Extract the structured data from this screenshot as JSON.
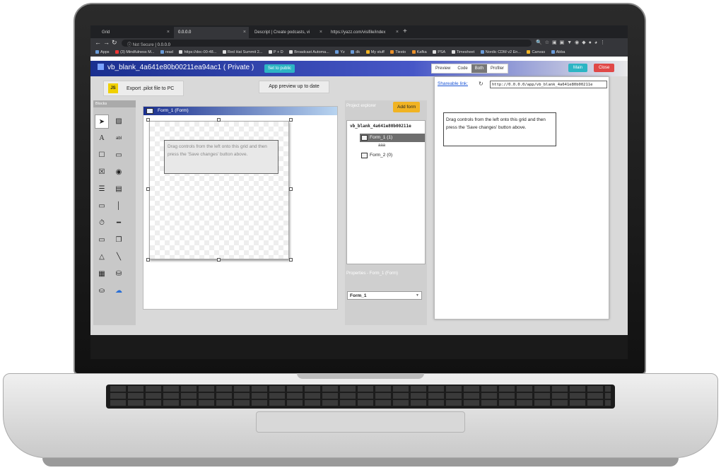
{
  "browser": {
    "tabs": [
      {
        "label": "Grid"
      },
      {
        "label": "0.0.0.0"
      },
      {
        "label": "Descript | Create podcasts, vi"
      },
      {
        "label": "https://yazz.com/visifile/index"
      }
    ],
    "security": "Not Secure",
    "url": "0.0.0.0",
    "bookmarks": [
      "Apps",
      "(3) Mindfulness M...",
      "read",
      "https://doc-00-48...",
      "Red Hat Summit 2...",
      "P + D",
      "Broadcast Automa...",
      "Yz",
      "dk",
      "My stuff",
      "Tiesto",
      "Kafka",
      "PSA",
      "Timesheet",
      "Nordic CDM v2 En...",
      "Canvas",
      "Abba"
    ]
  },
  "app": {
    "title": "vb_blank_4a641e80b00211ea94ac1 ( Private )",
    "set_public": "Set to public",
    "view_tabs": [
      "Preview",
      "Code",
      "Both",
      "Profiler"
    ],
    "selected_view": "Both",
    "main_label": "Main",
    "close_label": "Close",
    "export_label": "Export .pilot file to PC",
    "export_badge": "JS",
    "app_preview_label": "App preview up to date"
  },
  "blocks": {
    "title": "Blocks",
    "tools": [
      "pointer-icon",
      "image-icon",
      "text-label-icon",
      "textbox-icon",
      "checkbox-icon",
      "button-icon",
      "close-box-icon",
      "radio-icon",
      "list-icon",
      "form-list-icon",
      "progress-bar-icon",
      "slider-icon",
      "timer-icon",
      "line-thick-icon",
      "folder-icon",
      "copy-icon",
      "shapes-icon",
      "line-icon",
      "chart-icon",
      "database-icon",
      "db-query-icon",
      "cloud-icon"
    ],
    "text_tool_glyph": "A",
    "textbox_glyph": "abl"
  },
  "designer": {
    "form_title": "Form_1 (Form)",
    "hint": "Drag controls from the left onto this grid and then press the 'Save changes' button above."
  },
  "explorer": {
    "title": "Project explorer",
    "add_form": "Add form",
    "root": "vb_blank_4a641e80b00211e",
    "items": [
      {
        "label": "Form_1 (1)",
        "selected": true
      },
      {
        "label": "Form_2 (0)",
        "selected": false
      }
    ],
    "sub_item": "aaa"
  },
  "properties": {
    "title": "Properties - Form_1 (Form)",
    "selected": "Form_1"
  },
  "preview": {
    "share_label": "Shareable link:",
    "share_url": "http://0.0.0.0/app/vb_blank_4a641e80b00211e",
    "hint": "Drag controls from the left onto this grid and then press the 'Save changes' button above."
  }
}
